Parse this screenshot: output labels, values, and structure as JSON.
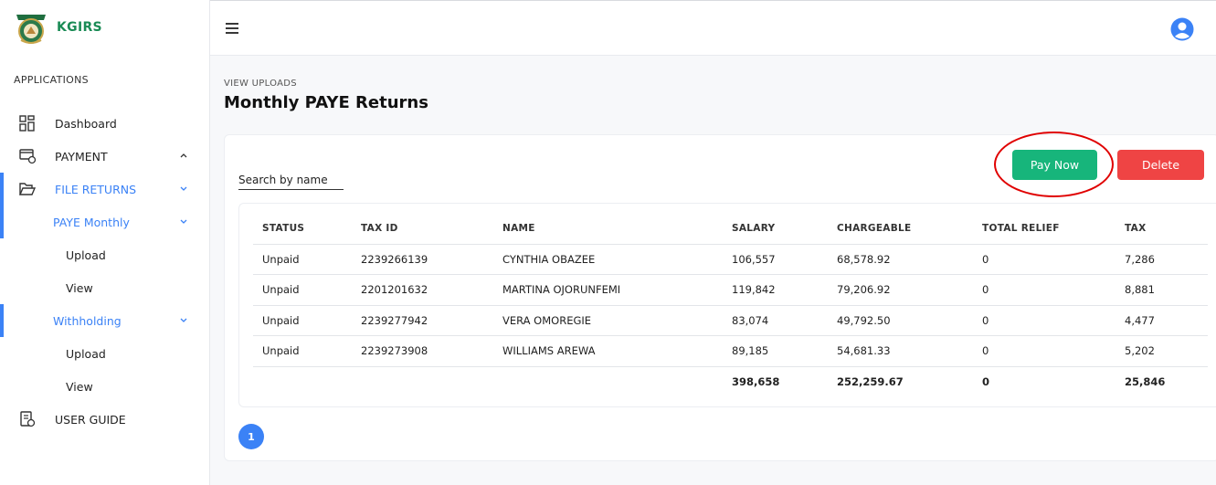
{
  "brand": {
    "name": "KGIRS",
    "logo_text": "KGIRS"
  },
  "sidebar": {
    "section_label": "APPLICATIONS",
    "items": [
      {
        "label": "Dashboard",
        "icon": "dashboard-grid-icon"
      },
      {
        "label": "PAYMENT",
        "icon": "payment-card-icon",
        "chevron": "up"
      },
      {
        "label": "FILE RETURNS",
        "icon": "folder-open-icon",
        "chevron": "down",
        "active": true
      },
      {
        "label": "PAYE Monthly",
        "chevron": "down",
        "active": true
      },
      {
        "label": "Upload"
      },
      {
        "label": "View"
      },
      {
        "label": "Withholding",
        "chevron": "down",
        "active": true
      },
      {
        "label": "Upload"
      },
      {
        "label": "View"
      },
      {
        "label": "USER GUIDE",
        "icon": "user-guide-icon"
      }
    ]
  },
  "header": {
    "menu_icon": "hamburger-icon",
    "avatar_icon": "user-avatar-icon"
  },
  "page": {
    "breadcrumb": "VIEW UPLOADS",
    "title": "Monthly PAYE Returns"
  },
  "toolbar": {
    "search_placeholder": "Search by name",
    "pay_label": "Pay Now",
    "delete_label": "Delete"
  },
  "table": {
    "columns": [
      "STATUS",
      "TAX ID",
      "NAME",
      "SALARY",
      "CHARGEABLE",
      "TOTAL RELIEF",
      "TAX"
    ],
    "rows": [
      [
        "Unpaid",
        "2239266139",
        "CYNTHIA OBAZEE",
        "106,557",
        "68,578.92",
        "0",
        "7,286"
      ],
      [
        "Unpaid",
        "2201201632",
        "MARTINA OJORUNFEMI",
        "119,842",
        "79,206.92",
        "0",
        "8,881"
      ],
      [
        "Unpaid",
        "2239277942",
        "VERA OMOREGIE",
        "83,074",
        "49,792.50",
        "0",
        "4,477"
      ],
      [
        "Unpaid",
        "2239273908",
        "WILLIAMS AREWA",
        "89,185",
        "54,681.33",
        "0",
        "5,202"
      ]
    ],
    "totals": [
      "",
      "",
      "",
      "398,658",
      "252,259.67",
      "0",
      "25,846"
    ]
  },
  "pagination": {
    "current": "1"
  },
  "colors": {
    "accent": "#3b82f6",
    "brand_green": "#1a8b55",
    "pay": "#17b57b",
    "delete": "#ef4444",
    "annotation_ring": "#e00000"
  }
}
